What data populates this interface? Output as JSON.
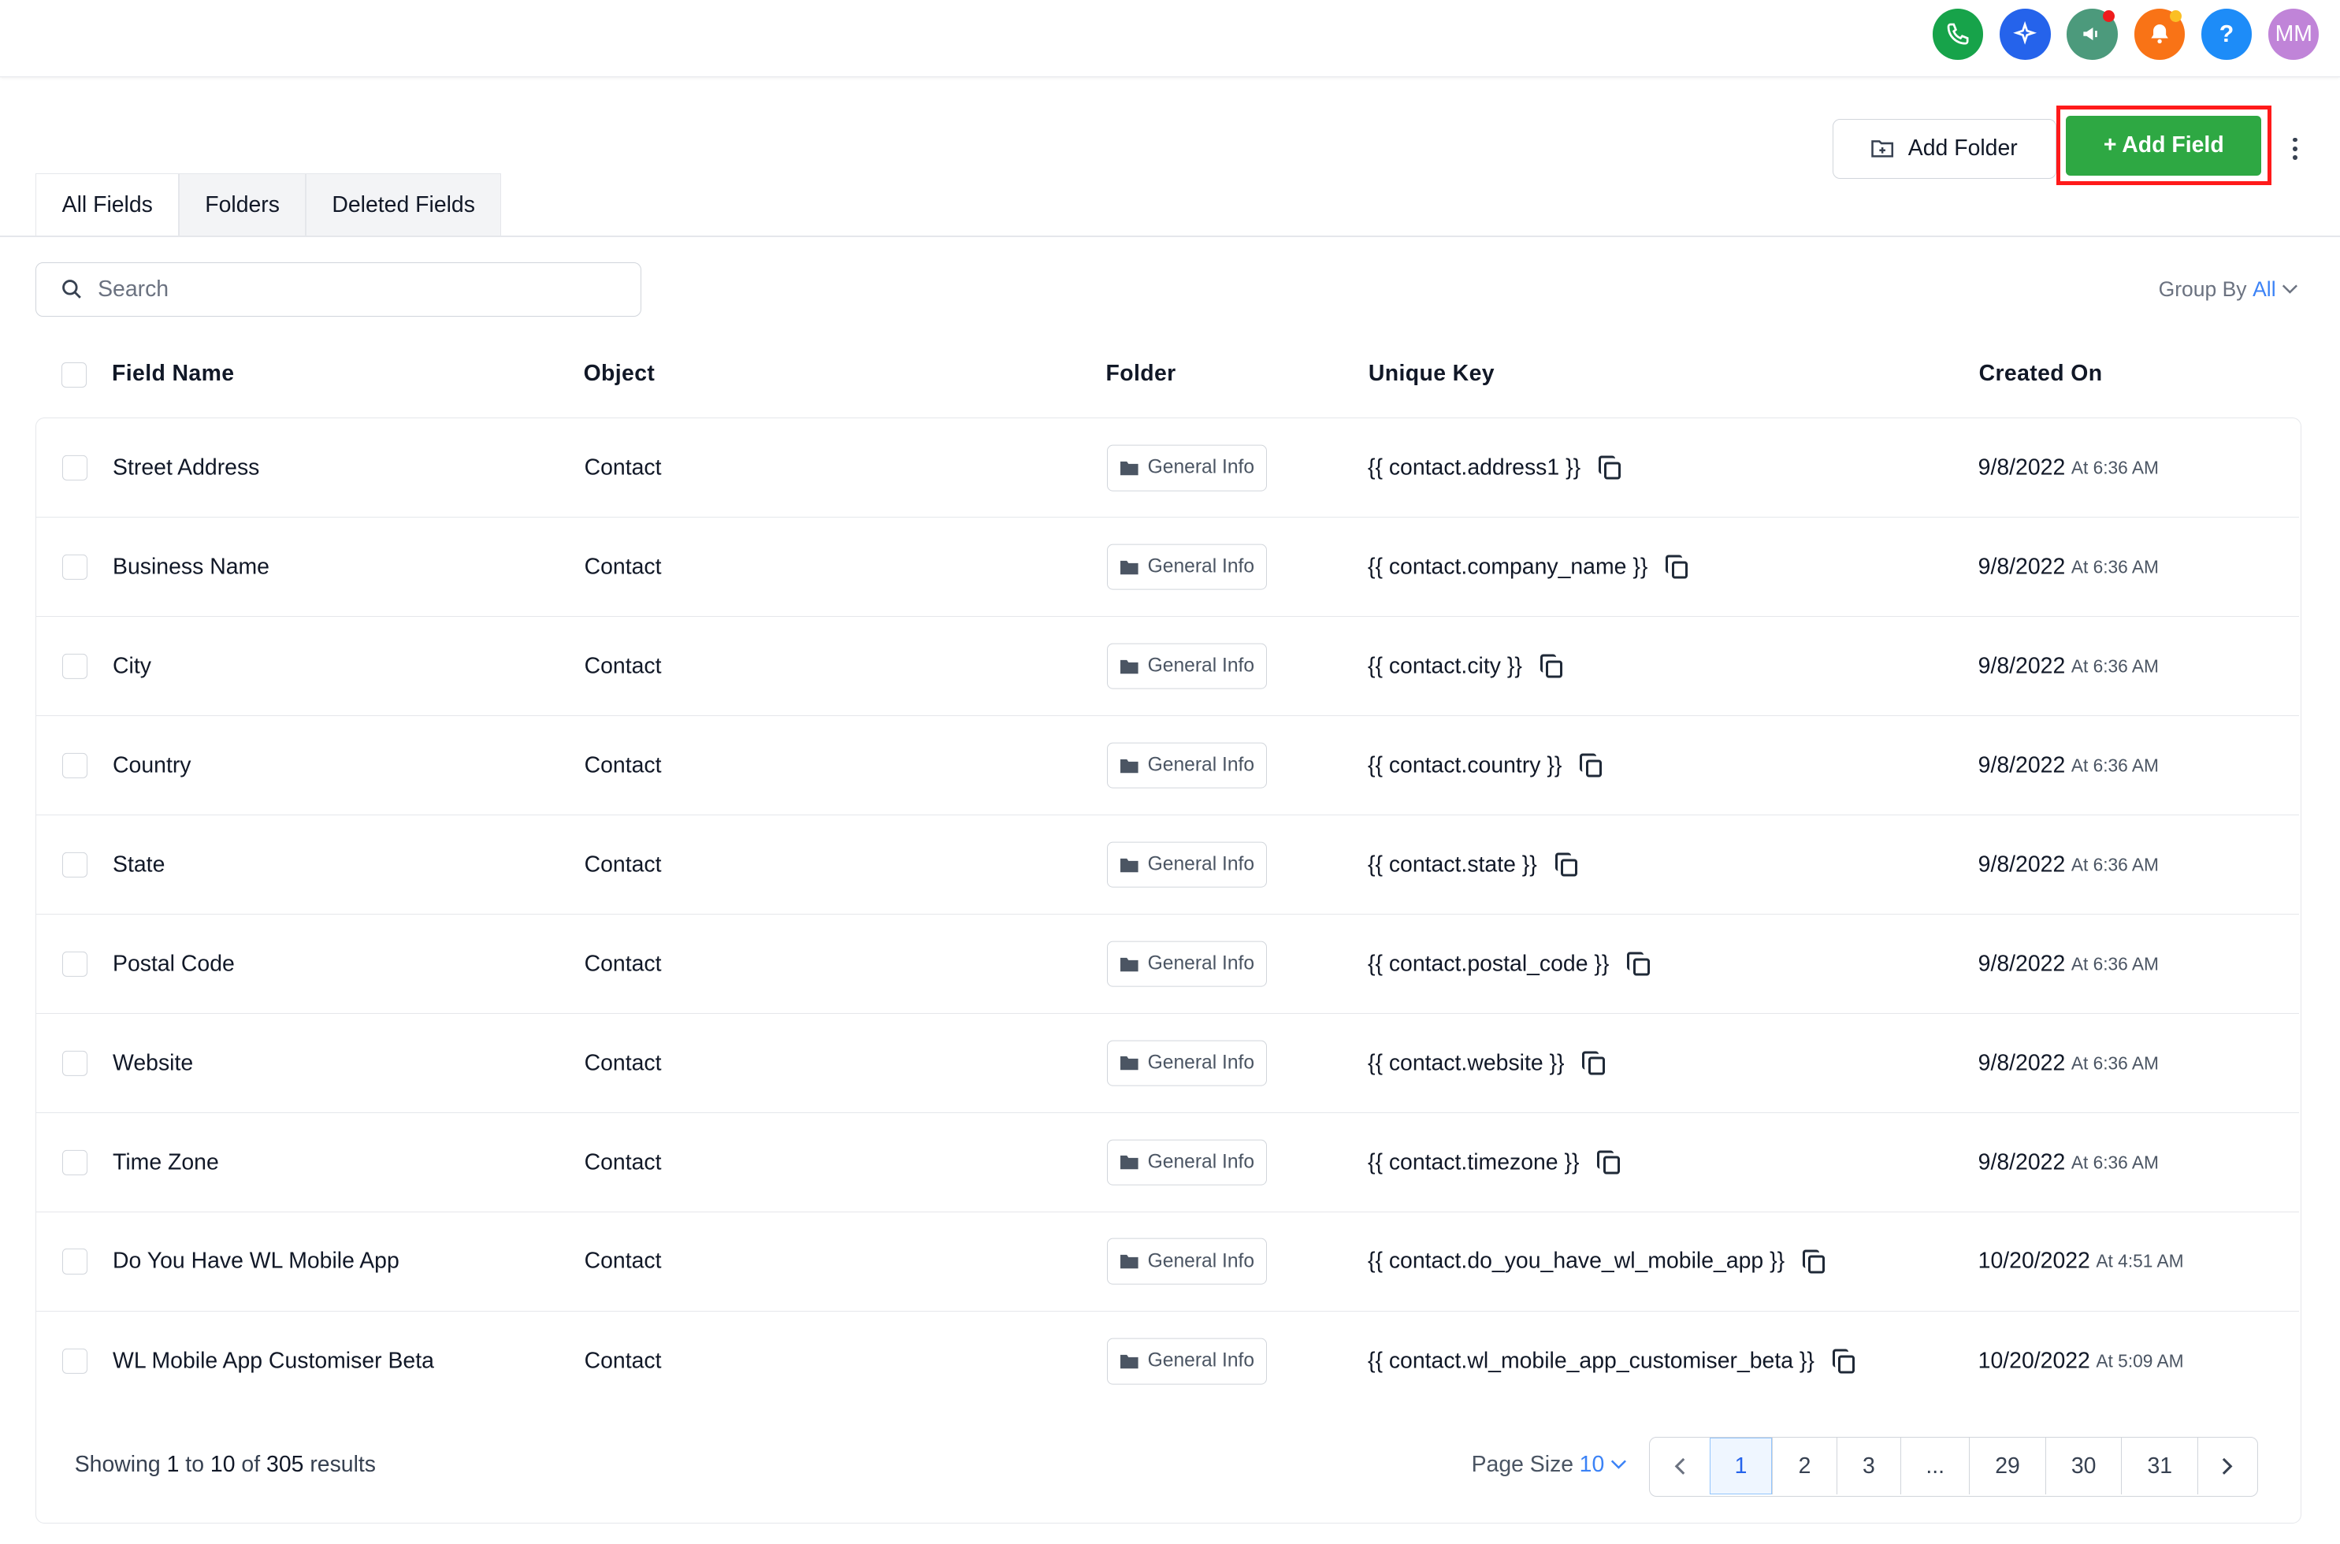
{
  "topbar": {
    "icons": [
      {
        "name": "phone-icon",
        "color": "#17a34a"
      },
      {
        "name": "sparkle-icon",
        "color": "#2563eb"
      },
      {
        "name": "megaphone-icon",
        "color": "#4c9a7c"
      },
      {
        "name": "bell-icon",
        "color": "#f97316"
      },
      {
        "name": "help-icon",
        "color": "#1d8cf8",
        "label": "?"
      },
      {
        "name": "avatar",
        "color": "#c084d8",
        "label": "MM"
      }
    ]
  },
  "actions": {
    "add_folder_label": "Add Folder",
    "add_field_label": "+ Add Field"
  },
  "tabs": [
    "All Fields",
    "Folders",
    "Deleted Fields"
  ],
  "search": {
    "placeholder": "Search"
  },
  "group_by": {
    "label": "Group By",
    "value": "All"
  },
  "columns": {
    "field_name": "Field Name",
    "object": "Object",
    "folder": "Folder",
    "unique_key": "Unique Key",
    "created_on": "Created On"
  },
  "rows": [
    {
      "field": "Street Address",
      "object": "Contact",
      "folder": "General Info",
      "key": "{{ contact.address1 }}",
      "date": "9/8/2022",
      "time": "At 6:36 AM"
    },
    {
      "field": "Business Name",
      "object": "Contact",
      "folder": "General Info",
      "key": "{{ contact.company_name }}",
      "date": "9/8/2022",
      "time": "At 6:36 AM"
    },
    {
      "field": "City",
      "object": "Contact",
      "folder": "General Info",
      "key": "{{ contact.city }}",
      "date": "9/8/2022",
      "time": "At 6:36 AM"
    },
    {
      "field": "Country",
      "object": "Contact",
      "folder": "General Info",
      "key": "{{ contact.country }}",
      "date": "9/8/2022",
      "time": "At 6:36 AM"
    },
    {
      "field": "State",
      "object": "Contact",
      "folder": "General Info",
      "key": "{{ contact.state }}",
      "date": "9/8/2022",
      "time": "At 6:36 AM"
    },
    {
      "field": "Postal Code",
      "object": "Contact",
      "folder": "General Info",
      "key": "{{ contact.postal_code }}",
      "date": "9/8/2022",
      "time": "At 6:36 AM"
    },
    {
      "field": "Website",
      "object": "Contact",
      "folder": "General Info",
      "key": "{{ contact.website }}",
      "date": "9/8/2022",
      "time": "At 6:36 AM"
    },
    {
      "field": "Time Zone",
      "object": "Contact",
      "folder": "General Info",
      "key": "{{ contact.timezone }}",
      "date": "9/8/2022",
      "time": "At 6:36 AM"
    },
    {
      "field": "Do You Have WL Mobile App",
      "object": "Contact",
      "folder": "General Info",
      "key": "{{ contact.do_you_have_wl_mobile_app }}",
      "date": "10/20/2022",
      "time": "At 4:51 AM"
    },
    {
      "field": "WL Mobile App Customiser Beta",
      "object": "Contact",
      "folder": "General Info",
      "key": "{{ contact.wl_mobile_app_customiser_beta }}",
      "date": "10/20/2022",
      "time": "At 5:09 AM"
    }
  ],
  "footer": {
    "showing_prefix": "Showing",
    "from": "1",
    "to_word": "to",
    "to": "10",
    "of_word": "of",
    "total": "305",
    "results_word": "results",
    "page_size_label": "Page Size",
    "page_size_value": "10",
    "pages": [
      "1",
      "2",
      "3",
      "...",
      "29",
      "30",
      "31"
    ],
    "current_page": "1"
  }
}
